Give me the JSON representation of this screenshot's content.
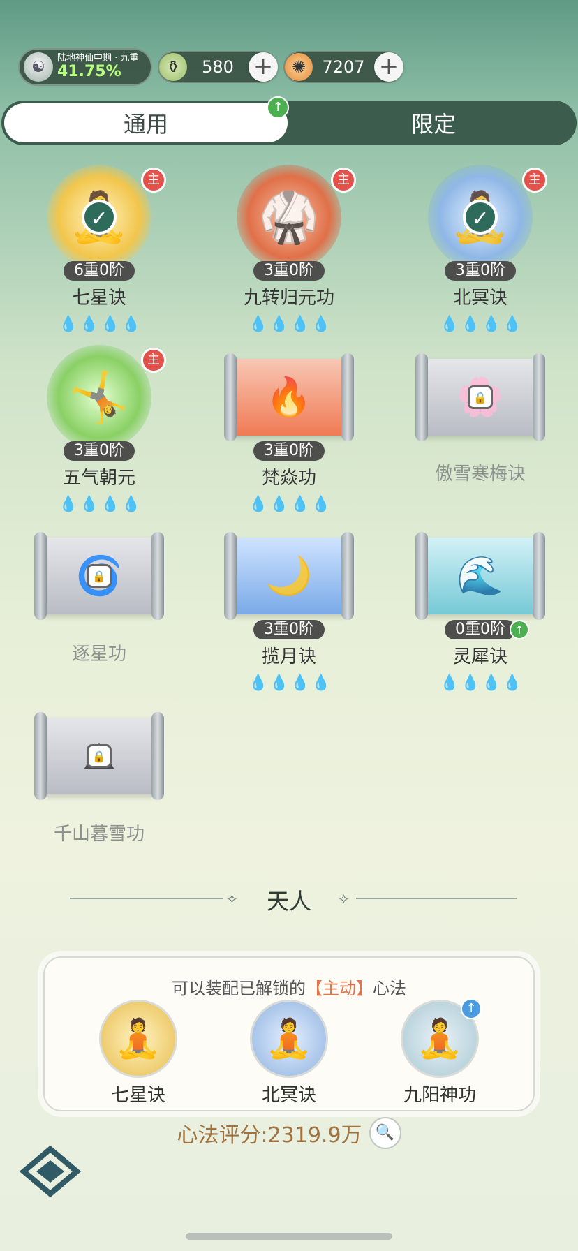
{
  "top": {
    "realm_title": "陆地神仙中期 · 九重",
    "realm_percent": "41.75%",
    "currency1": "580",
    "currency2": "7207",
    "plus": "+"
  },
  "tabs": {
    "general": "通用",
    "limited": "限定"
  },
  "cards": [
    {
      "name": "七星诀",
      "level": "6重0阶",
      "main": "主",
      "lit": 1
    },
    {
      "name": "九转归元功",
      "level": "3重0阶",
      "main": "主",
      "lit": 0
    },
    {
      "name": "北冥诀",
      "level": "3重0阶",
      "main": "主",
      "lit": 0
    },
    {
      "name": "五气朝元",
      "level": "3重0阶",
      "main": "主",
      "lit": 0
    },
    {
      "name": "梵焱功",
      "level": "3重0阶",
      "lit": 0
    },
    {
      "name": "傲雪寒梅诀"
    },
    {
      "name": "逐星功"
    },
    {
      "name": "揽月诀",
      "level": "3重0阶",
      "lit": 0
    },
    {
      "name": "灵犀诀",
      "level": "0重0阶",
      "lit": 0
    },
    {
      "name": "千山暮雪功"
    }
  ],
  "section_title": "天人",
  "panel": {
    "hint_prefix": "可以装配已解锁的",
    "hint_bracket": "【主动】",
    "hint_suffix": "心法",
    "slots": [
      "七星诀",
      "北冥诀",
      "九阳神功"
    ]
  },
  "score": "心法评分:2319.9万",
  "colors": {
    "accent_red": "#e2514a",
    "accent_green": "#4caf50",
    "score_color": "#a0723f"
  }
}
